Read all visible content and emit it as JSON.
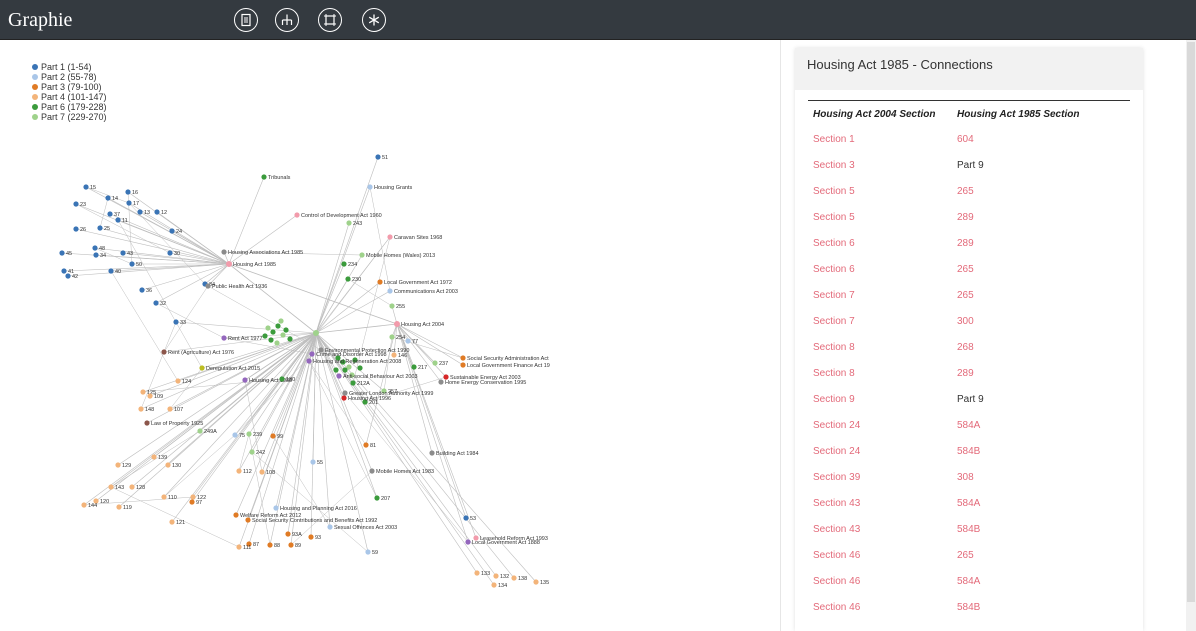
{
  "app": {
    "title": "Graphie",
    "tools": [
      {
        "name": "document-icon"
      },
      {
        "name": "hierarchy-icon"
      },
      {
        "name": "frame-icon"
      },
      {
        "name": "asterisk-icon"
      }
    ]
  },
  "colors": {
    "part1": "#3a74b5",
    "part2": "#a9c6e8",
    "part3": "#e07b25",
    "part4": "#f3b47a",
    "part6": "#3b9b3c",
    "part7": "#9fd28b",
    "act": "#f29bab",
    "other": "#8c8c8c",
    "red": "#d62728",
    "purple": "#9467bd",
    "brown": "#8c564b",
    "olive": "#bcbd22",
    "edge": "#bdbdbd",
    "link": "#e36a7a"
  },
  "legend": [
    {
      "label": "Part 1 (1-54)",
      "color": "#3a74b5"
    },
    {
      "label": "Part 2 (55-78)",
      "color": "#a9c6e8"
    },
    {
      "label": "Part 3 (79-100)",
      "color": "#e07b25"
    },
    {
      "label": "Part 4 (101-147)",
      "color": "#f3b47a"
    },
    {
      "label": "Part 6 (179-228)",
      "color": "#3b9b3c"
    },
    {
      "label": "Part 7 (229-270)",
      "color": "#9fd28b"
    }
  ],
  "panel": {
    "title": "Housing Act 1985 - Connections",
    "col1_header": "Housing Act 2004 Section",
    "col2_header": "Housing Act 1985 Section",
    "rows": [
      {
        "a": "Section 1",
        "b": "604",
        "b_link": true
      },
      {
        "a": "Section 3",
        "b": "Part 9",
        "b_link": false
      },
      {
        "a": "Section 5",
        "b": "265",
        "b_link": true
      },
      {
        "a": "Section 5",
        "b": "289",
        "b_link": true
      },
      {
        "a": "Section 6",
        "b": "289",
        "b_link": true
      },
      {
        "a": "Section 6",
        "b": "265",
        "b_link": true
      },
      {
        "a": "Section 7",
        "b": "265",
        "b_link": true
      },
      {
        "a": "Section 7",
        "b": "300",
        "b_link": true
      },
      {
        "a": "Section 8",
        "b": "268",
        "b_link": true
      },
      {
        "a": "Section 8",
        "b": "289",
        "b_link": true
      },
      {
        "a": "Section 9",
        "b": "Part 9",
        "b_link": false
      },
      {
        "a": "Section 24",
        "b": "584A",
        "b_link": true
      },
      {
        "a": "Section 24",
        "b": "584B",
        "b_link": true
      },
      {
        "a": "Section 39",
        "b": "308",
        "b_link": true
      },
      {
        "a": "Section 43",
        "b": "584A",
        "b_link": true
      },
      {
        "a": "Section 43",
        "b": "584B",
        "b_link": true
      },
      {
        "a": "Section 46",
        "b": "265",
        "b_link": true
      },
      {
        "a": "Section 46",
        "b": "584A",
        "b_link": true
      },
      {
        "a": "Section 46",
        "b": "584B",
        "b_link": true
      }
    ]
  },
  "graph": {
    "hubs": [
      {
        "id": "h1985",
        "label": "Housing Act 1985",
        "group": "act"
      },
      {
        "id": "h2004",
        "label": "Housing Act 2004",
        "group": "act"
      },
      {
        "id": "hmid",
        "label": "",
        "group": "part7"
      }
    ],
    "nodes": [
      {
        "label": "15",
        "group": "part1",
        "hub": "h1985"
      },
      {
        "label": "14",
        "group": "part1",
        "hub": "h1985"
      },
      {
        "label": "16",
        "group": "part1",
        "hub": "h1985"
      },
      {
        "label": "17",
        "group": "part1",
        "hub": "h1985"
      },
      {
        "label": "23",
        "group": "part1",
        "hub": "h1985"
      },
      {
        "label": "37",
        "group": "part1",
        "hub": "h1985"
      },
      {
        "label": "11",
        "group": "part1",
        "hub": "h1985"
      },
      {
        "label": "13",
        "group": "part1",
        "hub": "h1985"
      },
      {
        "label": "12",
        "group": "part1",
        "hub": "h1985"
      },
      {
        "label": "26",
        "group": "part1",
        "hub": "h1985"
      },
      {
        "label": "25",
        "group": "part1",
        "hub": "h1985"
      },
      {
        "label": "48",
        "group": "part1",
        "hub": "h1985"
      },
      {
        "label": "24",
        "group": "part1",
        "hub": "h1985"
      },
      {
        "label": "45",
        "group": "part1",
        "hub": "h1985"
      },
      {
        "label": "34",
        "group": "part1",
        "hub": "h1985"
      },
      {
        "label": "43",
        "group": "part1",
        "hub": "h1985"
      },
      {
        "label": "30",
        "group": "part1",
        "hub": "h1985"
      },
      {
        "label": "50",
        "group": "part1",
        "hub": "h1985"
      },
      {
        "label": "41",
        "group": "part1",
        "hub": "h1985"
      },
      {
        "label": "42",
        "group": "part1",
        "hub": "h1985"
      },
      {
        "label": "40",
        "group": "part1",
        "hub": "h1985"
      },
      {
        "label": "36",
        "group": "part1",
        "hub": "h1985"
      },
      {
        "label": "32",
        "group": "part1",
        "hub": "h1985"
      },
      {
        "label": "33",
        "group": "part1",
        "hub": "hmid"
      },
      {
        "label": "84",
        "group": "part1",
        "hub": "h1985"
      },
      {
        "label": "51",
        "group": "part1",
        "hub": "hmid"
      },
      {
        "label": "Housing Grants",
        "group": "part2",
        "hub": "hmid"
      },
      {
        "label": "Tribunals",
        "group": "part6",
        "hub": "h1985"
      },
      {
        "label": "Control of Development Act 1960",
        "group": "act",
        "hub": "h1985"
      },
      {
        "label": "243",
        "group": "part7",
        "hub": "hmid"
      },
      {
        "label": "Caravan Sites 1968",
        "group": "act",
        "hub": "hmid"
      },
      {
        "label": "Mobile Homes (Wales) 2013",
        "group": "part7",
        "hub": "hmid"
      },
      {
        "label": "234",
        "group": "part6",
        "hub": "hmid"
      },
      {
        "label": "230",
        "group": "part6",
        "hub": "hmid"
      },
      {
        "label": "Local Government Act 1972",
        "group": "part3",
        "hub": "hmid"
      },
      {
        "label": "Communications Act 2003",
        "group": "part2",
        "hub": "hmid"
      },
      {
        "label": "255",
        "group": "part7",
        "hub": "h2004"
      },
      {
        "label": "254",
        "group": "part7",
        "hub": "h2004"
      },
      {
        "label": "77",
        "group": "part2",
        "hub": "h2004"
      },
      {
        "label": "146",
        "group": "part4",
        "hub": "h2004"
      },
      {
        "label": "Social Security Administration Act",
        "group": "part3",
        "hub": "h2004"
      },
      {
        "label": "Local Government Finance Act 19",
        "group": "part3",
        "hub": "h2004"
      },
      {
        "label": "217",
        "group": "part6",
        "hub": "h2004"
      },
      {
        "label": "237",
        "group": "part7",
        "hub": "h2004"
      },
      {
        "label": "Sustainable Energy Act 2003",
        "group": "red",
        "hub": "h2004"
      },
      {
        "label": "Home Energy Conservation 1995",
        "group": "other",
        "hub": "h2004"
      },
      {
        "label": "Rent Act 1977",
        "group": "purple",
        "hub": "hmid"
      },
      {
        "label": "Rent (Agriculture) Act 1976",
        "group": "brown",
        "hub": "hmid"
      },
      {
        "label": "Deregulation Act 2015",
        "group": "olive",
        "hub": "hmid"
      },
      {
        "label": "Housing Act 1988",
        "group": "purple",
        "hub": "hmid"
      },
      {
        "label": "124",
        "group": "part4",
        "hub": "hmid"
      },
      {
        "label": "125",
        "group": "part4",
        "hub": "hmid"
      },
      {
        "label": "109",
        "group": "part4",
        "hub": "hmid"
      },
      {
        "label": "148",
        "group": "part4",
        "hub": "hmid"
      },
      {
        "label": "107",
        "group": "part4",
        "hub": "hmid"
      },
      {
        "label": "Law of Property 1925",
        "group": "brown",
        "hub": "hmid"
      },
      {
        "label": "249A",
        "group": "part7",
        "hub": "hmid"
      },
      {
        "label": "239",
        "group": "part7",
        "hub": "hmid"
      },
      {
        "label": "75",
        "group": "part2",
        "hub": "hmid"
      },
      {
        "label": "99",
        "group": "part3",
        "hub": "hmid"
      },
      {
        "label": "242",
        "group": "part7",
        "hub": "hmid"
      },
      {
        "label": "55",
        "group": "part2",
        "hub": "hmid"
      },
      {
        "label": "81",
        "group": "part3",
        "hub": "h2004"
      },
      {
        "label": "Building Act 1984",
        "group": "other",
        "hub": "h2004"
      },
      {
        "label": "Mobile Homes Act 1983",
        "group": "other",
        "hub": "hmid"
      },
      {
        "label": "207",
        "group": "part6",
        "hub": "hmid"
      },
      {
        "label": "129",
        "group": "part4",
        "hub": "hmid"
      },
      {
        "label": "139",
        "group": "part4",
        "hub": "hmid"
      },
      {
        "label": "130",
        "group": "part4",
        "hub": "hmid"
      },
      {
        "label": "112",
        "group": "part4",
        "hub": "hmid"
      },
      {
        "label": "108",
        "group": "part4",
        "hub": "hmid"
      },
      {
        "label": "143",
        "group": "part4",
        "hub": "hmid"
      },
      {
        "label": "128",
        "group": "part4",
        "hub": "hmid"
      },
      {
        "label": "120",
        "group": "part4",
        "hub": "hmid"
      },
      {
        "label": "144",
        "group": "part4",
        "hub": "hmid"
      },
      {
        "label": "119",
        "group": "part4",
        "hub": "hmid"
      },
      {
        "label": "110",
        "group": "part4",
        "hub": "hmid"
      },
      {
        "label": "122",
        "group": "part4",
        "hub": "hmid"
      },
      {
        "label": "121",
        "group": "part4",
        "hub": "hmid"
      },
      {
        "label": "97",
        "group": "part3",
        "hub": "hmid"
      },
      {
        "label": "Welfare Reform Act 2012",
        "group": "part3",
        "hub": "hmid"
      },
      {
        "label": "Housing and Planning Act 2016",
        "group": "part2",
        "hub": "hmid"
      },
      {
        "label": "Social Security Contributions and Benefits Act 1992",
        "group": "part3",
        "hub": "hmid"
      },
      {
        "label": "Sexual Offences Act 2003",
        "group": "part2",
        "hub": "hmid"
      },
      {
        "label": "93A",
        "group": "part3",
        "hub": "hmid"
      },
      {
        "label": "93",
        "group": "part3",
        "hub": "hmid"
      },
      {
        "label": "87",
        "group": "part3",
        "hub": "hmid"
      },
      {
        "label": "88",
        "group": "part3",
        "hub": "hmid"
      },
      {
        "label": "89",
        "group": "part3",
        "hub": "hmid"
      },
      {
        "label": "111",
        "group": "part4",
        "hub": "hmid"
      },
      {
        "label": "59",
        "group": "part2",
        "hub": "hmid"
      },
      {
        "label": "53",
        "group": "part1",
        "hub": "h2004"
      },
      {
        "label": "Leasehold Reform Act 1993",
        "group": "act",
        "hub": "h2004"
      },
      {
        "label": "Local Government Act 1888",
        "group": "purple",
        "hub": "h2004"
      },
      {
        "label": "133",
        "group": "part4",
        "hub": "hmid"
      },
      {
        "label": "132",
        "group": "part4",
        "hub": "hmid"
      },
      {
        "label": "134",
        "group": "part4",
        "hub": "hmid"
      },
      {
        "label": "138",
        "group": "part4",
        "hub": "hmid"
      },
      {
        "label": "135",
        "group": "part4",
        "hub": "hmid"
      },
      {
        "label": "212A",
        "group": "part6",
        "hub": "hmid"
      },
      {
        "label": "257",
        "group": "part7",
        "hub": "hmid"
      },
      {
        "label": "201",
        "group": "part6",
        "hub": "hmid"
      },
      {
        "label": "180",
        "group": "part6",
        "hub": "hmid"
      },
      {
        "label": "Crime and Disorder Act 1998",
        "group": "purple",
        "hub": "hmid"
      },
      {
        "label": "Housing and Regeneration Act 2008",
        "group": "purple",
        "hub": "hmid"
      },
      {
        "label": "Anti-social Behaviour Act 2003",
        "group": "purple",
        "hub": "hmid"
      },
      {
        "label": "Housing Act 1996",
        "group": "red",
        "hub": "hmid"
      },
      {
        "label": "Environmental Protection Act 1990",
        "group": "other",
        "hub": "hmid"
      },
      {
        "label": "Greater London Authority Act 1999",
        "group": "other",
        "hub": "hmid"
      },
      {
        "label": "Housing Associations Act 1985",
        "group": "other",
        "hub": "h1985"
      },
      {
        "label": "Public Health Act 1936",
        "group": "other",
        "hub": "h1985"
      }
    ]
  }
}
